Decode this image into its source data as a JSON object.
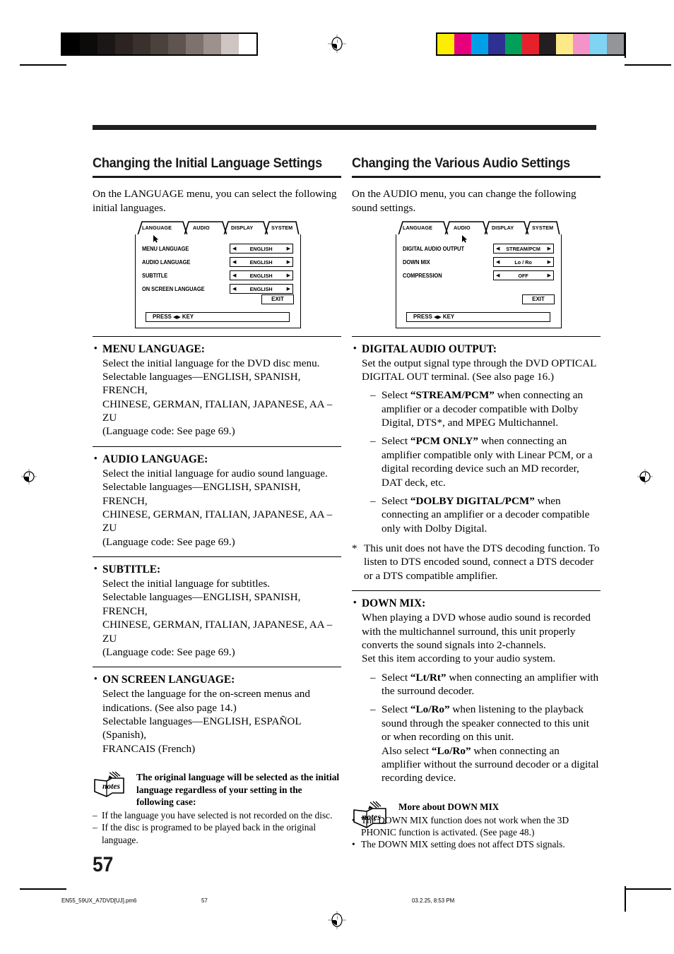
{
  "page": {
    "number": "57",
    "footer": {
      "file": "EN55_59UX_A7DVD[UJ].pm6",
      "page": "57",
      "date": "03.2.25, 8:53 PM"
    }
  },
  "print_marks": {
    "grayscale_swatches": [
      "#000000",
      "#0d0a0a",
      "#1c1717",
      "#2b2422",
      "#3a312e",
      "#4b413d",
      "#5f5450",
      "#7d726e",
      "#9d918d",
      "#cfc5c2",
      "#ffffff"
    ],
    "color_swatches": [
      "#fded00",
      "#e6007e",
      "#00a0e9",
      "#2e3192",
      "#00a05a",
      "#e7212b",
      "#231f20",
      "#fbe98a",
      "#f493c8",
      "#7fd4f4",
      "#939598"
    ]
  },
  "left_column": {
    "title": "Changing the Initial Language Settings",
    "intro": "On the LANGUAGE menu, you can select the following initial languages.",
    "osd": {
      "tabs": [
        {
          "label": "LANGUAGE",
          "active": true
        },
        {
          "label": "AUDIO",
          "active": false
        },
        {
          "label": "DISPLAY",
          "active": false
        },
        {
          "label": "SYSTEM",
          "active": false
        }
      ],
      "rows": [
        {
          "label": "MENU LANGUAGE",
          "value": "ENGLISH"
        },
        {
          "label": "AUDIO LANGUAGE",
          "value": "ENGLISH"
        },
        {
          "label": "SUBTITLE",
          "value": "ENGLISH"
        },
        {
          "label": "ON SCREEN LANGUAGE",
          "value": "ENGLISH"
        }
      ],
      "exit_label": "EXIT",
      "press_prefix": "PRESS",
      "press_suffix": "KEY",
      "left_arrow": "◀",
      "right_arrow": "▶"
    },
    "items": [
      {
        "heading": "MENU LANGUAGE:",
        "lines": [
          "Select the initial language for the DVD disc menu.",
          "Selectable languages—ENGLISH, SPANISH, FRENCH,",
          "CHINESE, GERMAN, ITALIAN, JAPANESE, AA – ZU",
          "(Language code: See page 69.)"
        ]
      },
      {
        "heading": "AUDIO LANGUAGE:",
        "lines": [
          "Select the initial language for audio sound language.",
          "Selectable languages—ENGLISH, SPANISH, FRENCH,",
          "CHINESE, GERMAN, ITALIAN, JAPANESE, AA – ZU",
          "(Language code: See page 69.)"
        ]
      },
      {
        "heading": "SUBTITLE:",
        "lines": [
          "Select the initial language for subtitles.",
          "Selectable languages—ENGLISH, SPANISH, FRENCH,",
          "CHINESE, GERMAN, ITALIAN, JAPANESE, AA – ZU",
          "(Language code: See page 69.)"
        ]
      },
      {
        "heading": "ON SCREEN LANGUAGE:",
        "lines": [
          "Select the language for the on-screen menus and",
          "indications. (See also page 14.)",
          "Selectable languages—ENGLISH, ESPAÑOL (Spanish),",
          "FRANCAIS (French)"
        ]
      }
    ],
    "notes": {
      "icon_label": "notes",
      "heading": "The original language will be selected as the initial language regardless of your setting in the following case:",
      "items": [
        {
          "marker": "–",
          "text": "If the language you have selected is not recorded on the disc."
        },
        {
          "marker": "–",
          "text": "If the disc is programed to be played back in the original language."
        }
      ]
    }
  },
  "right_column": {
    "title": "Changing the Various Audio Settings",
    "intro": "On the AUDIO menu, you can change the following sound settings.",
    "osd": {
      "tabs": [
        {
          "label": "LANGUAGE",
          "active": false
        },
        {
          "label": "AUDIO",
          "active": true
        },
        {
          "label": "DISPLAY",
          "active": false
        },
        {
          "label": "SYSTEM",
          "active": false
        }
      ],
      "rows": [
        {
          "label": "DIGITAL AUDIO OUTPUT",
          "value": "STREAM/PCM"
        },
        {
          "label": "DOWN MIX",
          "value": "Lo / Ro"
        },
        {
          "label": "COMPRESSION",
          "value": "OFF"
        }
      ],
      "exit_label": "EXIT",
      "press_prefix": "PRESS",
      "press_suffix": "KEY",
      "left_arrow": "◀",
      "right_arrow": "▶"
    },
    "digital_audio_output": {
      "heading": "DIGITAL AUDIO OUTPUT:",
      "lines": [
        "Set the output signal type through the DVD OPTICAL",
        "DIGITAL OUT terminal. (See also page 16.)"
      ],
      "options": [
        {
          "marker": "–",
          "prefix": "Select ",
          "bold": "“STREAM/PCM”",
          "suffix": " when connecting an amplifier or a decoder compatible with Dolby Digital, DTS*, and MPEG Multichannel."
        },
        {
          "marker": "–",
          "prefix": "Select ",
          "bold": "“PCM ONLY”",
          "suffix": " when connecting an amplifier compatible only with Linear PCM, or a digital recording device such an MD recorder, DAT deck, etc."
        },
        {
          "marker": "–",
          "prefix": "Select ",
          "bold": "“DOLBY DIGITAL/PCM”",
          "suffix": " when connecting an amplifier or a decoder compatible only with Dolby Digital."
        }
      ],
      "footnote": {
        "marker": "*",
        "text": "This unit does not have the DTS decoding function. To listen to DTS encoded sound, connect a DTS decoder or a DTS compatible amplifier."
      }
    },
    "down_mix": {
      "heading": "DOWN MIX:",
      "lines": [
        "When playing a DVD whose audio sound is recorded",
        "with the multichannel surround, this unit properly",
        "converts the sound signals into 2-channels.",
        "Set this item according to your audio system."
      ],
      "options": [
        {
          "marker": "–",
          "prefix": "Select ",
          "bold": "“Lt/Rt”",
          "suffix": " when connecting an amplifier with the surround decoder."
        },
        {
          "marker": "–",
          "prefix": "Select ",
          "bold": "“Lo/Ro”",
          "suffix": " when listening to the playback sound through the speaker connected to this unit or when recording on this unit.",
          "extra_prefix": "Also select ",
          "extra_bold": "“Lo/Ro”",
          "extra_suffix": " when connecting an amplifier without the surround decoder or a digital recording device."
        }
      ]
    },
    "notes": {
      "icon_label": "notes",
      "heading": "More about DOWN MIX",
      "items": [
        {
          "marker": "•",
          "text": "The DOWN MIX function does not work when the 3D PHONIC function is activated. (See page 48.)"
        },
        {
          "marker": "•",
          "text": "The DOWN MIX setting does not affect DTS signals."
        }
      ]
    }
  }
}
